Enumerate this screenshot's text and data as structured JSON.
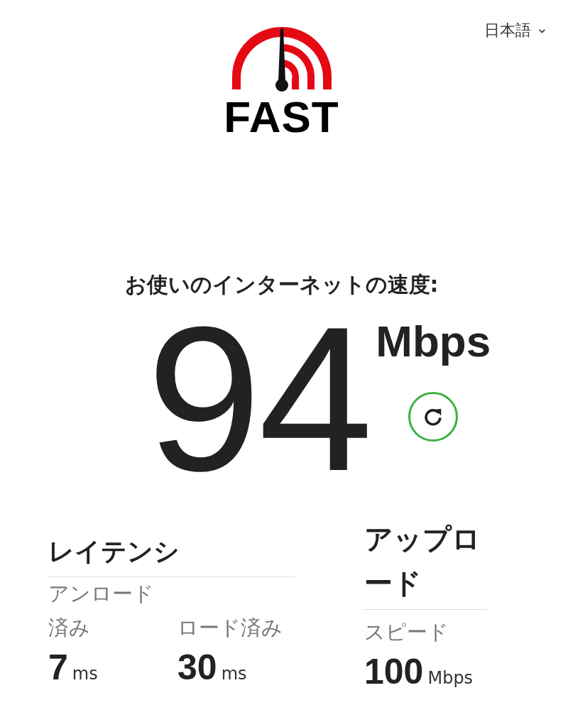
{
  "language_selector": {
    "label": "日本語"
  },
  "logo": {
    "text": "FAST"
  },
  "heading": "お使いのインターネットの速度:",
  "speed": {
    "value": "94",
    "unit": "Mbps"
  },
  "latency": {
    "title": "レイテンシ",
    "metrics": [
      {
        "label": "アンロード済み",
        "value": "7",
        "unit": "ms"
      },
      {
        "label": "ロード済み",
        "value": "30",
        "unit": "ms"
      }
    ]
  },
  "upload": {
    "title": "アップロード",
    "metrics": [
      {
        "label": "スピード",
        "value": "100",
        "unit": "Mbps"
      }
    ]
  }
}
